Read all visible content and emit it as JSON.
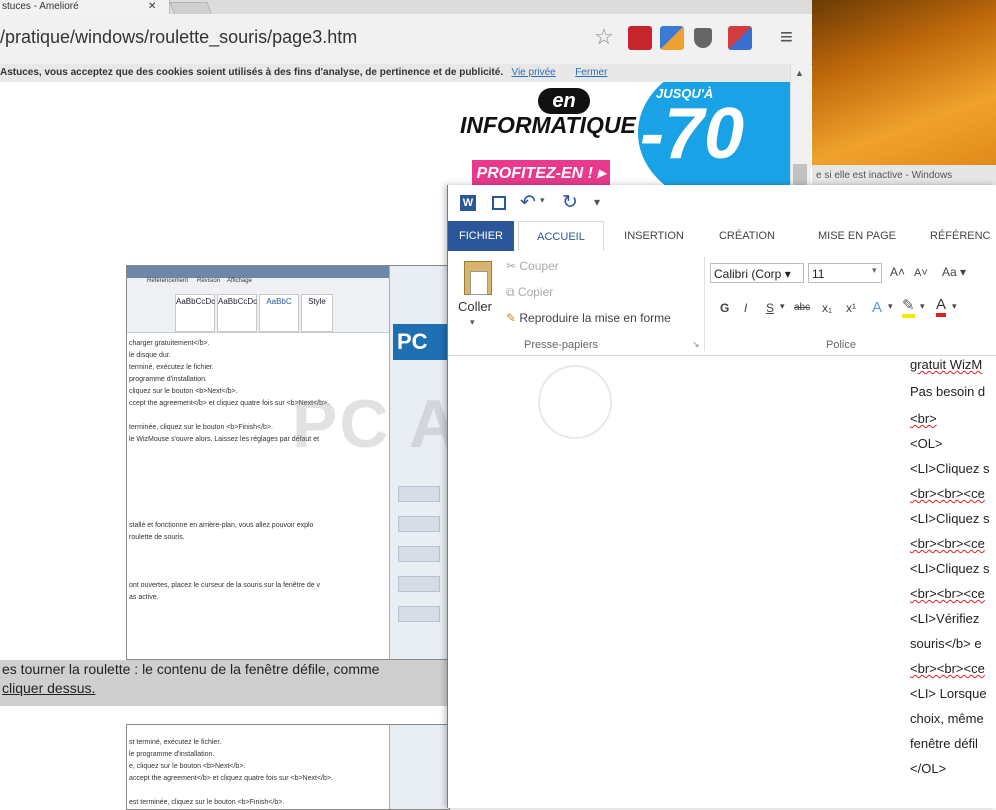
{
  "browser": {
    "tab_title": "stuces - Amelioré",
    "tab_close": "✕",
    "url": "/pratique/windows/roulette_souris/page3.htm",
    "star_icon": "☆",
    "menu_icon": "≡",
    "cookie_text": "Astuces, vous acceptez que des cookies soient utilisés à des fins d'analyse, de pertinence et de publicité.",
    "cookie_privacy": "Vie privée",
    "cookie_close": "Fermer",
    "scroll_up": "▲"
  },
  "ad": {
    "en": "en",
    "informatique": "INFORMATIQUE",
    "jusqua": "JUSQU'À",
    "pct": "-70",
    "button": "PROFITEZ-EN ! ▸"
  },
  "desktop_strip": "e si elle est inactive - Windows",
  "shot1": {
    "ribbon_tabs": [
      "Référencement",
      "Révision",
      "Affichage"
    ],
    "styles": [
      "AaBbCcDc",
      "AaBbCcDc",
      "AaBbC",
      "Style"
    ],
    "lines": [
      "charger gratuitement</b>.",
      "le disque dur.",
      "terminé, exécutez le fichier.",
      "programme d'installation.",
      "cliquez sur le bouton <b>Next</b>.",
      "ccept the agreement</b> et cliquez quatre fois sur <b>Next</b>.",
      "",
      "terminée, cliquez sur le bouton <b>Finish</b>.",
      "le WizMouse s'ouvre alors. Laissez les réglages par défaut et",
      "",
      "",
      "",
      "",
      "",
      "stallé et fonctionne en arrière-plan, vous allez pouvoir explo",
      "roulette de souris.",
      "",
      "",
      "ont ouvertes, placez le curseur de la souris sur la fenêtre de v",
      "as active."
    ],
    "pc": "PC"
  },
  "watermark": "PC ASTUCES",
  "paragraph": "es tourner la roulette : le contenu de la fenêtre défile, comme\ncliquer dessus.",
  "shot2": {
    "lines": [
      "st terminé, exécutez le fichier.",
      "le programme d'installation.",
      "e, cliquez sur le bouton <b>Next</b>.",
      "accept the agreement</b> et cliquez quatre fois sur <b>Next</b>.",
      "",
      "est terminée, cliquez sur le bouton <b>Finish</b>."
    ]
  },
  "word": {
    "tabs": [
      "FICHIER",
      "ACCUEIL",
      "INSERTION",
      "CRÉATION",
      "MISE EN PAGE",
      "RÉFÉRENC"
    ],
    "clipboard": {
      "paste": "Coller",
      "cut": "Couper",
      "copy": "Copier",
      "format_painter": "Reproduire la mise en forme",
      "group": "Presse-papiers"
    },
    "font": {
      "name": "Calibri (Corp",
      "size": "11",
      "grow": "A˄",
      "shrink": "A˅",
      "case": "Aa",
      "bold": "G",
      "italic": "I",
      "underline": "S",
      "strike": "abc",
      "sub": "x₁",
      "sup": "x¹",
      "group": "Police"
    },
    "doc_lines": [
      "gratuit WizM",
      "Pas besoin d",
      "<br>",
      "<OL>",
      "<LI>Cliquez s",
      "<br><br><ce",
      "<LI>Cliquez s",
      "<br><br><ce",
      "<LI>Cliquez s",
      "<br><br><ce",
      "<LI>Vérifiez",
      "souris</b> e",
      "<br><br><ce",
      "<LI> Lorsque",
      "choix, même",
      "fenêtre défil",
      "</OL>"
    ]
  },
  "colors": {
    "word_blue": "#2b579a",
    "ad_blue": "#1aa2e6",
    "ad_pink": "#e8398c"
  }
}
